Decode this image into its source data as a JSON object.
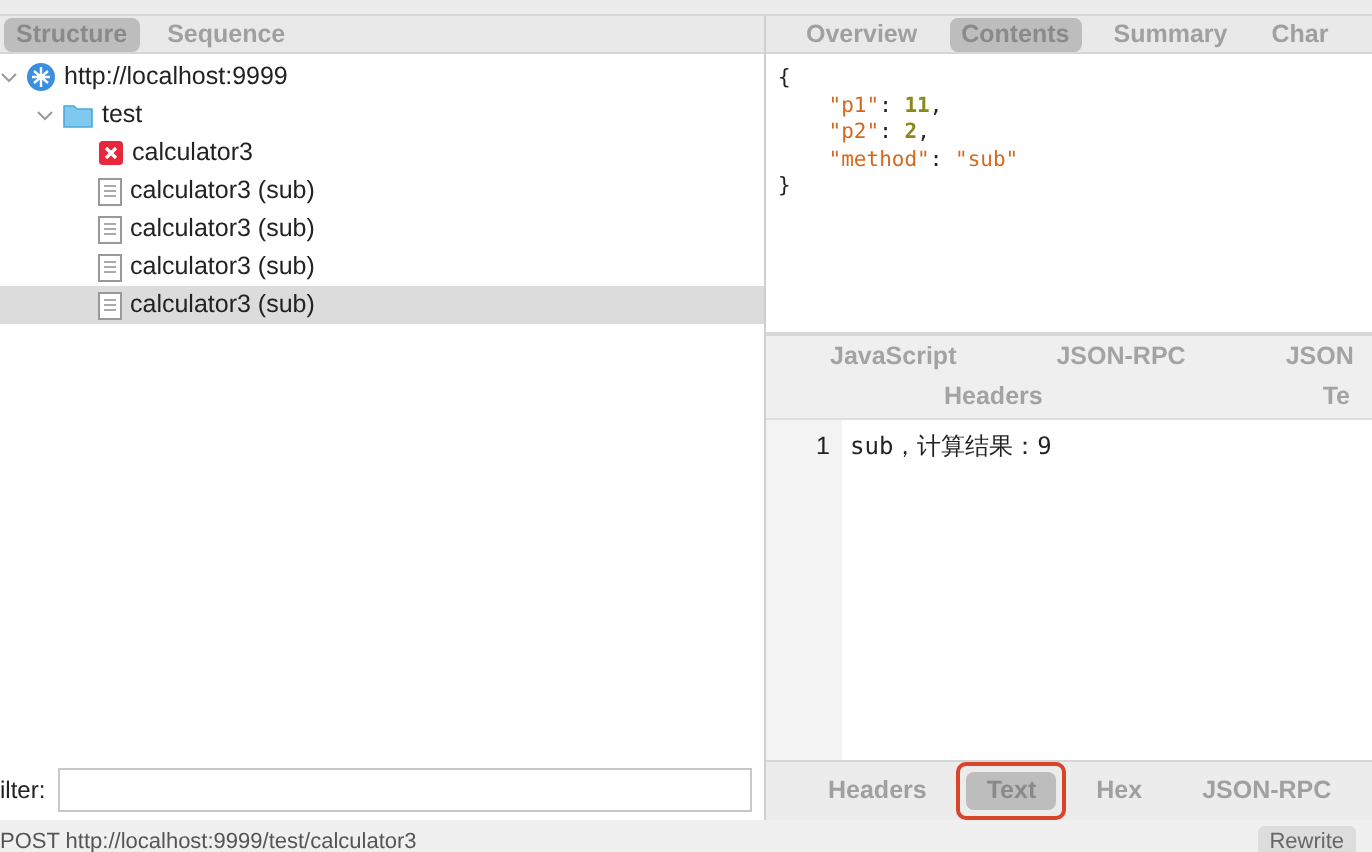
{
  "left_tabs": [
    {
      "label": "Structure",
      "selected": true
    },
    {
      "label": "Sequence",
      "selected": false
    }
  ],
  "tree": [
    {
      "label": "http://localhost:9999",
      "kind": "host",
      "expanded": true,
      "selected": false,
      "children": [
        {
          "label": "test",
          "kind": "folder",
          "expanded": true,
          "selected": false,
          "children": [
            {
              "label": "calculator3",
              "kind": "error",
              "selected": false
            },
            {
              "label": "calculator3 (sub)",
              "kind": "document",
              "selected": false
            },
            {
              "label": "calculator3 (sub)",
              "kind": "document",
              "selected": false
            },
            {
              "label": "calculator3 (sub)",
              "kind": "document",
              "selected": false
            },
            {
              "label": "calculator3 (sub)",
              "kind": "document",
              "selected": true
            }
          ]
        }
      ]
    }
  ],
  "filter": {
    "label": "ilter:"
  },
  "status_bar": {
    "text": "POST http://localhost:9999/test/calculator3",
    "button": "Rewrite"
  },
  "top_tabs": [
    {
      "label": "Overview",
      "selected": false
    },
    {
      "label": "Contents",
      "selected": true
    },
    {
      "label": "Summary",
      "selected": false
    },
    {
      "label": "Char",
      "selected": false
    }
  ],
  "request_body": [
    {
      "indented": false,
      "parts": [
        {
          "t": "{",
          "kind": "punct"
        }
      ]
    },
    {
      "indented": true,
      "parts": [
        {
          "t": "\"p1\"",
          "kind": "key"
        },
        {
          "t": ": ",
          "kind": "punct"
        },
        {
          "t": "11",
          "kind": "number"
        },
        {
          "t": ",",
          "kind": "punct"
        }
      ]
    },
    {
      "indented": true,
      "parts": [
        {
          "t": "\"p2\"",
          "kind": "key"
        },
        {
          "t": ": ",
          "kind": "punct"
        },
        {
          "t": "2",
          "kind": "number"
        },
        {
          "t": ",",
          "kind": "punct"
        }
      ]
    },
    {
      "indented": true,
      "parts": [
        {
          "t": "\"method\"",
          "kind": "key"
        },
        {
          "t": ": ",
          "kind": "punct"
        },
        {
          "t": "\"sub\"",
          "kind": "string"
        }
      ]
    },
    {
      "indented": false,
      "parts": [
        {
          "t": "}",
          "kind": "punct"
        }
      ]
    }
  ],
  "response_tabs_row1": [
    "JavaScript",
    "JSON-RPC",
    "JSON"
  ],
  "response_tabs_row2": [
    "Headers",
    "Te"
  ],
  "response_lines": [
    {
      "number": "1",
      "text": "sub，计算结果：9"
    }
  ],
  "bottom_tabs": [
    {
      "label": "Headers",
      "selected": false,
      "highlighted": false
    },
    {
      "label": "Text",
      "selected": true,
      "highlighted": true
    },
    {
      "label": "Hex",
      "selected": false,
      "highlighted": false
    },
    {
      "label": "JSON-RPC",
      "selected": false,
      "highlighted": false
    }
  ]
}
